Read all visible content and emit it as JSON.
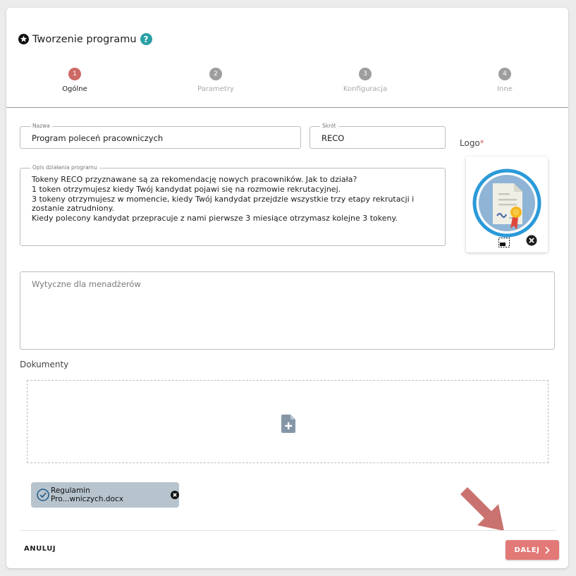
{
  "header": {
    "title": "Tworzenie programu",
    "help_icon": "?"
  },
  "stepper": {
    "steps": [
      {
        "number": "1",
        "label": "Ogólne",
        "state": "active"
      },
      {
        "number": "2",
        "label": "Parametry",
        "state": "inactive"
      },
      {
        "number": "3",
        "label": "Konfiguracja",
        "state": "inactive"
      },
      {
        "number": "4",
        "label": "Inne",
        "state": "inactive"
      }
    ]
  },
  "form": {
    "name": {
      "legend": "Nazwa",
      "value": "Program poleceń pracowniczych"
    },
    "short": {
      "legend": "Skrót",
      "value": "RECO"
    },
    "description": {
      "legend": "Opis działania programu",
      "value": "Tokeny RECO przyznawane są za rekomendację nowych pracowników. Jak to działa?\n1 token otrzymujesz kiedy Twój kandydat pojawi się na rozmowie rekrutacyjnej.\n3 tokeny otrzymujesz w momencie, kiedy Twój kandydat przejdzie wszystkie trzy etapy rekrutacji i\nzostanie zatrudniony.\nKiedy polecony kandydat przepracuje z nami pierwsze 3 miesiące otrzymasz kolejne 3 tokeny."
    },
    "guidelines": {
      "placeholder": "Wytyczne dla menadżerów",
      "value": ""
    },
    "logo": {
      "label": "Logo",
      "required_mark": "*"
    }
  },
  "documents": {
    "label": "Dokumenty",
    "files": [
      {
        "name": "Regulamin Pro...wniczych.docx",
        "status": "uploaded"
      }
    ]
  },
  "footer": {
    "cancel_label": "ANULUJ",
    "next_label": "DALEJ"
  },
  "colors": {
    "accent": "#e27977",
    "step_active": "#cd6a66",
    "step_inactive": "#9e9e9e",
    "help": "#2aa0a6",
    "chip": "#b7c4ce",
    "arrow": "#c9726f"
  }
}
